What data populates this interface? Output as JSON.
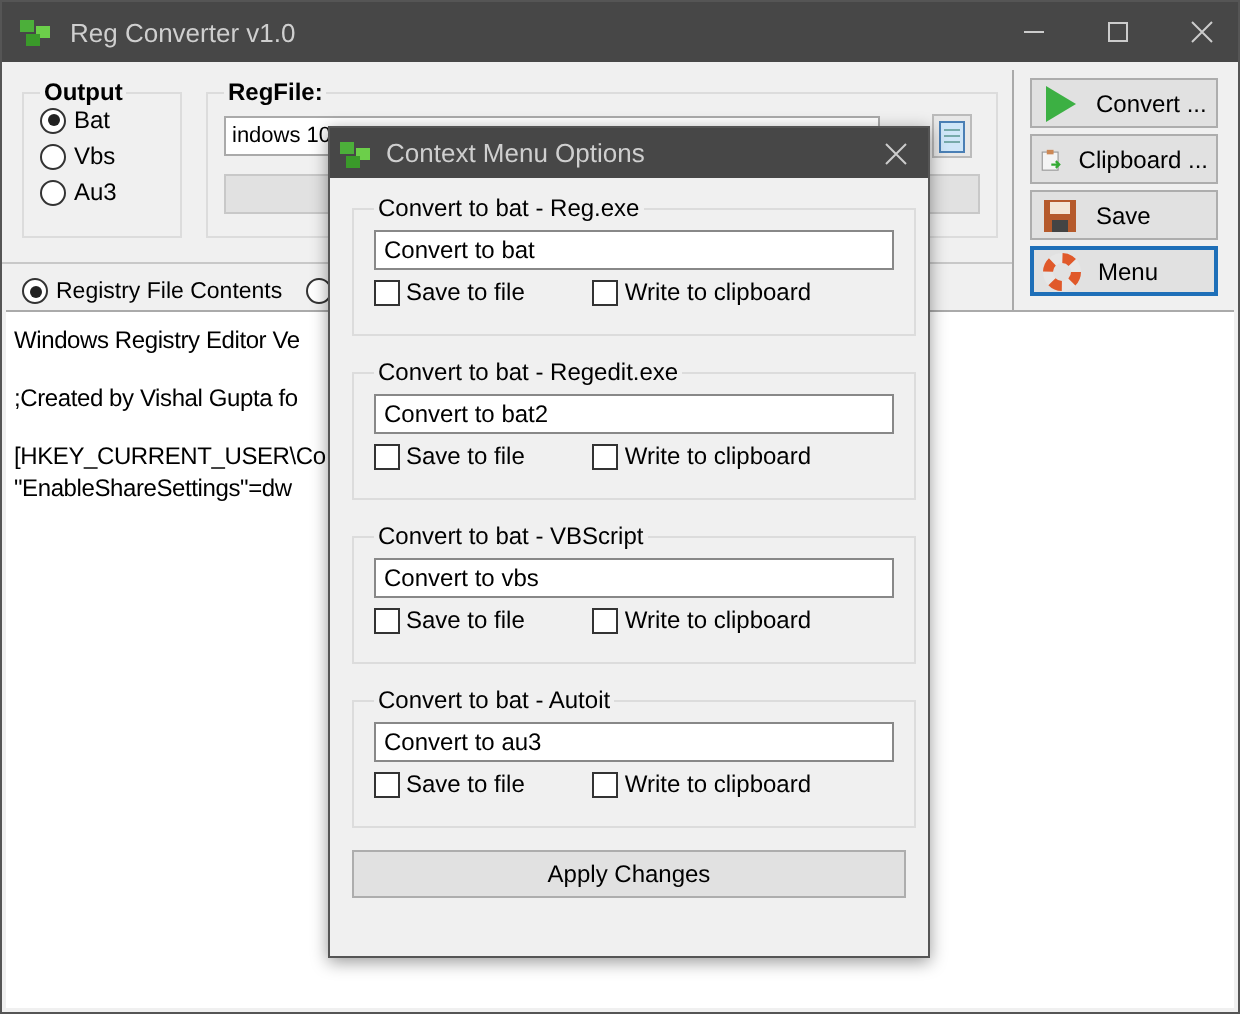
{
  "window": {
    "title": "Reg Converter v1.0"
  },
  "output_group": {
    "title": "Output",
    "options": [
      {
        "label": "Bat",
        "selected": true
      },
      {
        "label": "Vbs",
        "selected": false
      },
      {
        "label": "Au3",
        "selected": false
      }
    ]
  },
  "regfile_group": {
    "title": "RegFile:",
    "path_value": "indows 10"
  },
  "actions": [
    {
      "label": "Convert ...",
      "kind": "play",
      "focused": false
    },
    {
      "label": "Clipboard ...",
      "kind": "clipboard",
      "focused": false
    },
    {
      "label": "Save",
      "kind": "disk",
      "focused": false
    },
    {
      "label": "Menu",
      "kind": "lifebuoy",
      "focused": true
    }
  ],
  "view_options": [
    {
      "label": "Registry File Contents",
      "selected": true
    },
    {
      "selected": false
    }
  ],
  "contents": [
    [
      "Windows Registry Editor Ve"
    ],
    [
      ";Created by Vishal Gupta fo"
    ],
    [
      "[HKEY_CURRENT_USER\\Co",
      "\"EnableShareSettings\"=dw"
    ]
  ],
  "dialog": {
    "title": "Context Menu Options",
    "groups": [
      {
        "title": "Convert to bat - Reg.exe",
        "value": "Convert to bat",
        "options": [
          {
            "label": "Save to file",
            "checked": false
          },
          {
            "label": "Write to clipboard",
            "checked": false
          }
        ]
      },
      {
        "title": "Convert to bat - Regedit.exe",
        "value": "Convert to bat2",
        "options": [
          {
            "label": "Save to file",
            "checked": false
          },
          {
            "label": "Write to clipboard",
            "checked": false
          }
        ]
      },
      {
        "title": "Convert to bat - VBScript",
        "value": "Convert to vbs",
        "options": [
          {
            "label": "Save to file",
            "checked": false
          },
          {
            "label": "Write to clipboard",
            "checked": false
          }
        ]
      },
      {
        "title": "Convert to bat - Autoit",
        "value": "Convert to au3",
        "options": [
          {
            "label": "Save to file",
            "checked": false
          },
          {
            "label": "Write to clipboard",
            "checked": false
          }
        ]
      }
    ],
    "apply_button": "Apply Changes"
  }
}
